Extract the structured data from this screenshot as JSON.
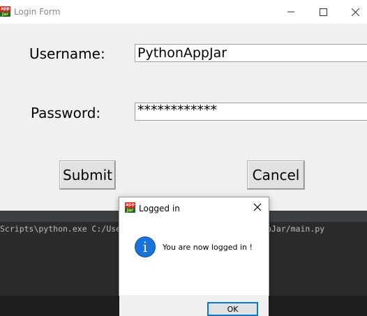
{
  "window": {
    "title": "Login Form",
    "icon": "appjar-icon",
    "icon_top": "app",
    "icon_bottom": "Jar",
    "controls": [
      "minimize-icon",
      "maximize-icon",
      "close-icon"
    ]
  },
  "form": {
    "username_label": "Username:",
    "username_value": "PythonAppJar",
    "password_label": "Password:",
    "password_value": "************",
    "submit_label": "Submit",
    "cancel_label": "Cancel"
  },
  "terminal": {
    "line_left": "Scripts\\python.exe C:/Use",
    "line_right": "pJar/main.py"
  },
  "dialog": {
    "title": "Logged in",
    "icon": "info-icon",
    "icon_glyph": "i",
    "message": "You are now logged in !",
    "ok_label": "OK"
  },
  "colors": {
    "accent": "#0078d7",
    "info_blue": "#1a73d8",
    "window_bg": "#f0f0f0",
    "terminal_bg": "#2b2b2b"
  }
}
